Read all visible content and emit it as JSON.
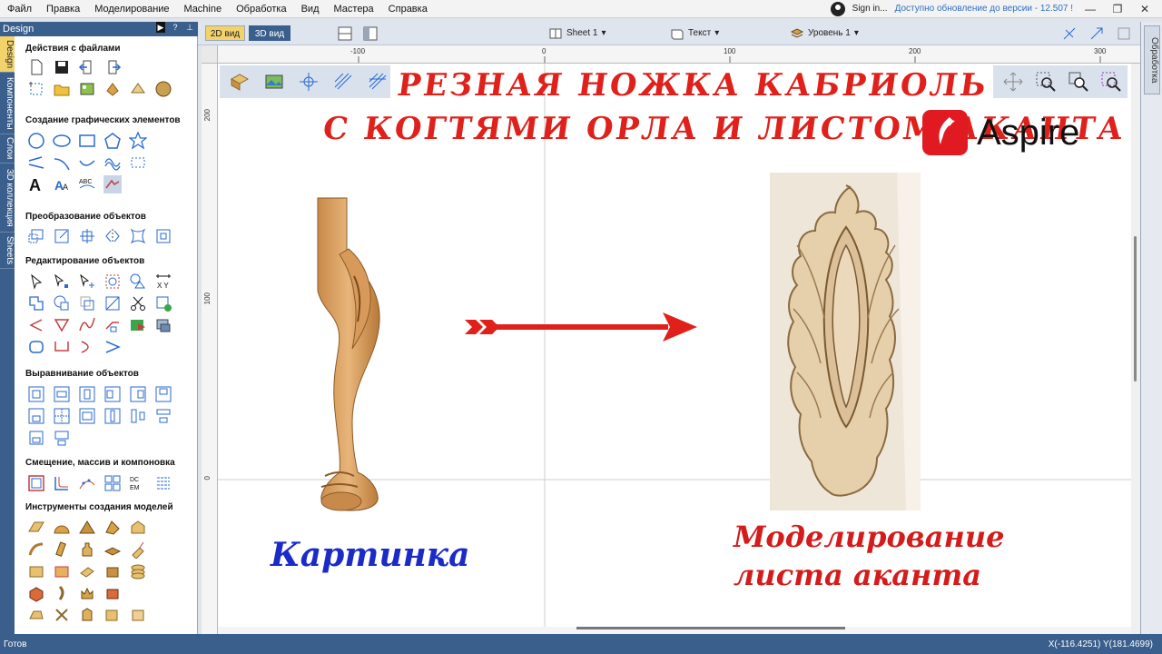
{
  "menu": {
    "items": [
      "Файл",
      "Правка",
      "Моделирование",
      "Machine",
      "Обработка",
      "Вид",
      "Мастера",
      "Справка"
    ],
    "sign_in": "Sign in...",
    "update": "Доступно обновление до версии - 12.507 !"
  },
  "left_panel": {
    "title": "Design",
    "tabs": [
      "Design",
      "Компоненты",
      "Слои",
      "3D коллекция",
      "Sheets"
    ],
    "sections": [
      "Действия с файлами",
      "Создание графических элементов",
      "Преобразование объектов",
      "Редактирование объектов",
      "Выравнивание объектов",
      "Смещение, массив и компоновка",
      "Инструменты создания моделей"
    ]
  },
  "right_panel": {
    "tab": "Обработка"
  },
  "view_toolbar": {
    "view_2d": "2D вид",
    "view_3d": "3D вид",
    "sheet": "Sheet 1",
    "text": "Текст",
    "level": "Уровень 1"
  },
  "rulers": {
    "top": [
      "-100",
      "0",
      "100",
      "200",
      "300"
    ],
    "left": [
      "200",
      "100",
      "0"
    ]
  },
  "canvas": {
    "title_line1": "РЕЗНАЯ НОЖКА КАБРИОЛЬ",
    "title_line2": "С КОГТЯМИ ОРЛА И ЛИСТОМ АКАНТА",
    "logo_text": "Aspire",
    "caption_left": "Картинка",
    "caption_right_line1": "Моделирование",
    "caption_right_line2": "листа аканта"
  },
  "status": {
    "text": "Готов",
    "coords": "X(-116.4251) Y(181.4699)"
  },
  "colors": {
    "accent_blue": "#3a5f8c",
    "title_red": "#e0201a",
    "caption_blue": "#1a2bc8",
    "wood": "#d9a66a"
  }
}
